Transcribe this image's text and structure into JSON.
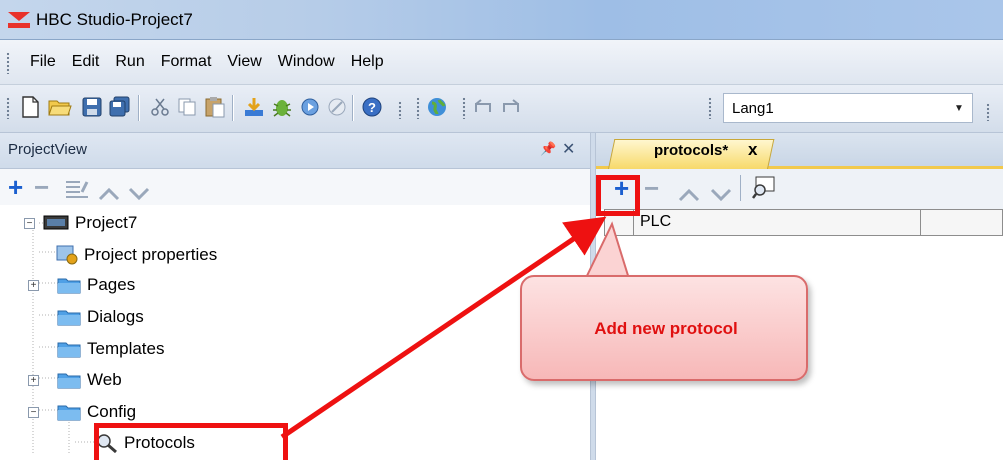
{
  "window": {
    "title": "HBC Studio-Project7",
    "logo_icon": "app-logo-icon"
  },
  "menu": {
    "items": [
      "File",
      "Edit",
      "Run",
      "Format",
      "View",
      "Window",
      "Help"
    ]
  },
  "toolbar": {
    "language_value": "Lang1",
    "icons": [
      "new-file-icon",
      "open-folder-icon",
      "save-icon",
      "save-all-icon",
      "cut-icon",
      "copy-icon",
      "paste-icon",
      "download-icon",
      "debug-bug-icon",
      "run-icon",
      "stop-icon",
      "help-icon",
      "globe-icon",
      "undo-icon",
      "redo-icon"
    ]
  },
  "project_view": {
    "title": "ProjectView",
    "tools": [
      "add-icon",
      "remove-icon",
      "rename-icon",
      "move-up-icon",
      "move-down-icon"
    ],
    "tree": [
      {
        "label": "Project7",
        "icon": "project-icon",
        "expander": "−"
      },
      {
        "label": "Project properties",
        "icon": "properties-icon"
      },
      {
        "label": "Pages",
        "icon": "folder-icon",
        "expander": "+"
      },
      {
        "label": "Dialogs",
        "icon": "folder-icon"
      },
      {
        "label": "Templates",
        "icon": "folder-icon"
      },
      {
        "label": "Web",
        "icon": "folder-icon",
        "expander": "+"
      },
      {
        "label": "Config",
        "icon": "folder-icon",
        "expander": "−"
      },
      {
        "label": "Protocols",
        "icon": "protocols-icon"
      }
    ]
  },
  "document": {
    "tab_label": "protocols*",
    "tab_close": "x",
    "grid_columns": [
      "PLC"
    ]
  },
  "callout": {
    "text": "Add new protocol"
  },
  "colors": {
    "highlight": "#ee1111",
    "callout_fill": "#f9c6c6",
    "tab_active": "#f7d96a"
  }
}
